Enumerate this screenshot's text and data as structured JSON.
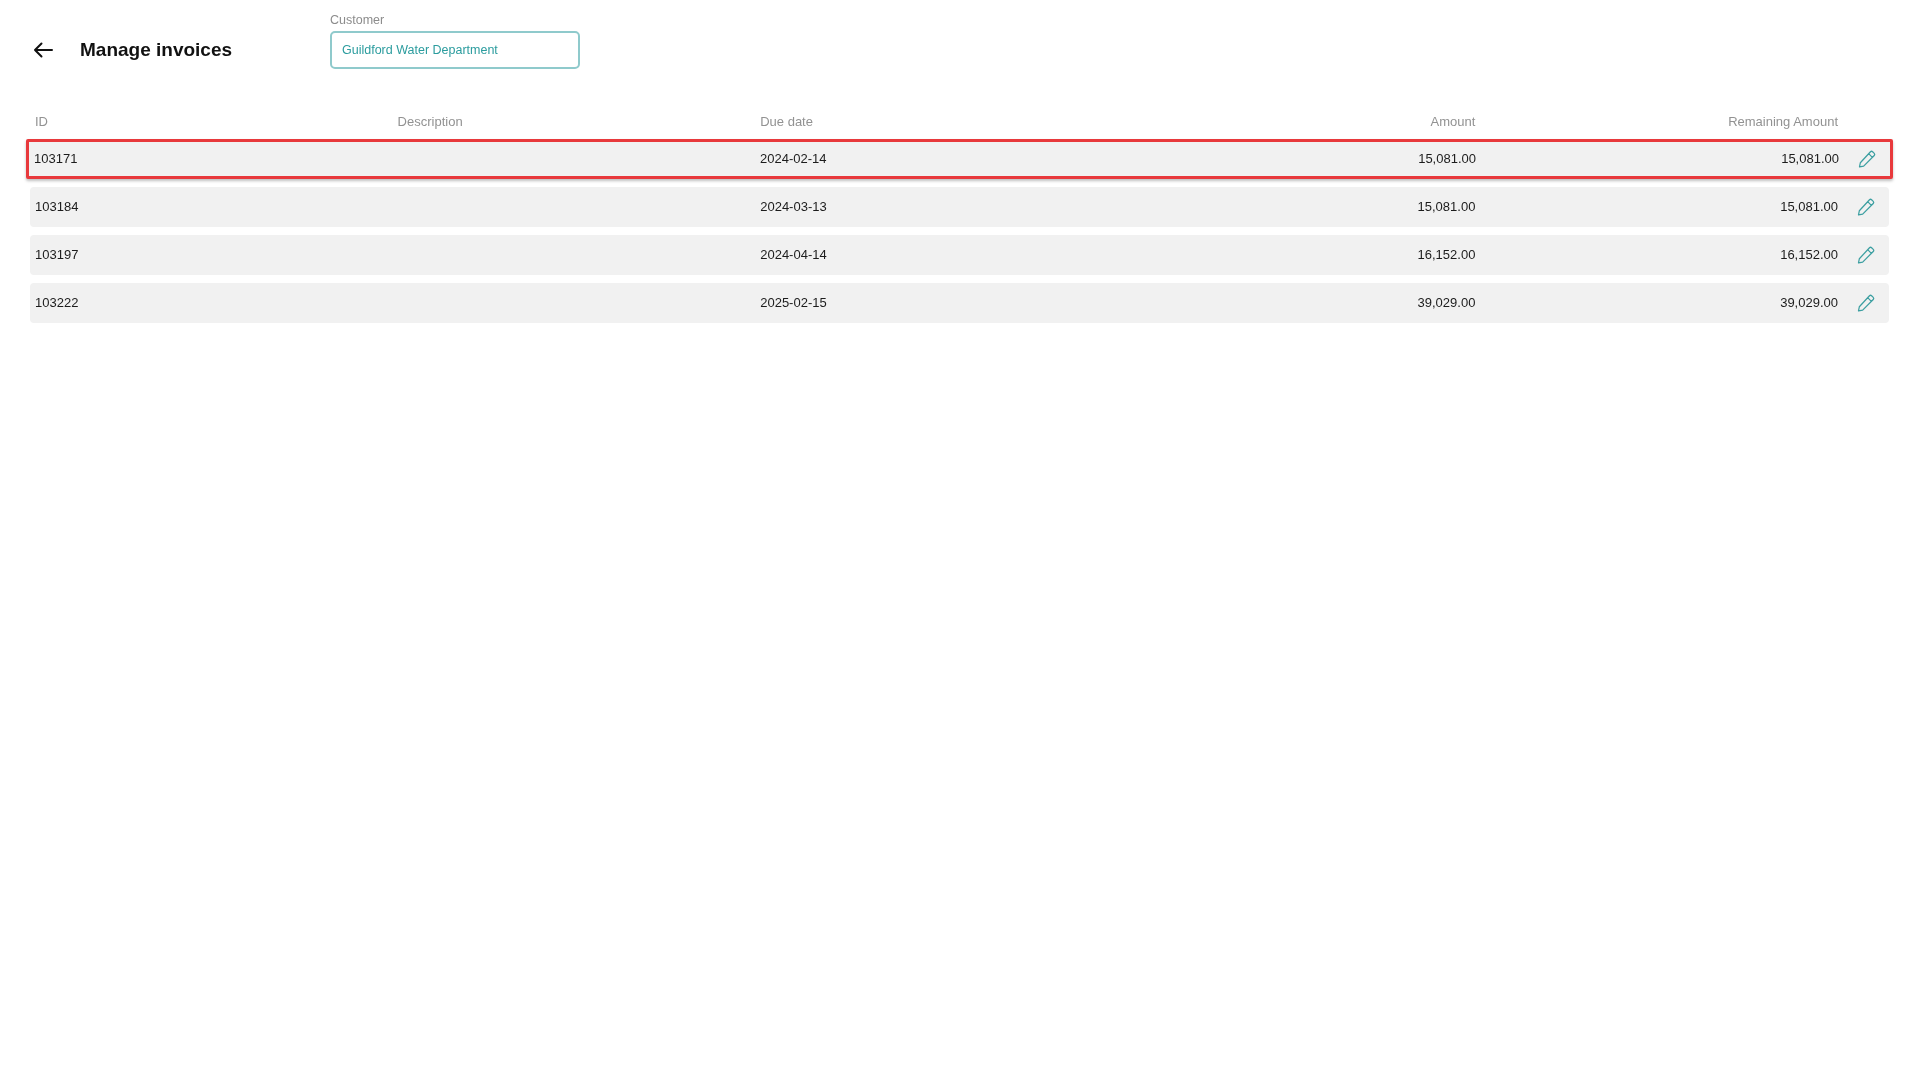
{
  "header": {
    "title": "Manage invoices"
  },
  "customer_field": {
    "label": "Customer",
    "value": "Guildford Water Department"
  },
  "table": {
    "columns": [
      "ID",
      "Description",
      "Due date",
      "Amount",
      "Remaining Amount"
    ],
    "rows": [
      {
        "id": "103171",
        "due_date": "2024-02-14",
        "amount": "15,081.00",
        "remaining_amount": "15,081.00",
        "selected": true
      },
      {
        "id": "103184",
        "due_date": "2024-03-13",
        "amount": "15,081.00",
        "remaining_amount": "15,081.00",
        "selected": false
      },
      {
        "id": "103197",
        "due_date": "2024-04-14",
        "amount": "16,152.00",
        "remaining_amount": "16,152.00",
        "selected": false
      },
      {
        "id": "103222",
        "due_date": "2025-02-15",
        "amount": "39,029.00",
        "remaining_amount": "39,029.00",
        "selected": false
      }
    ]
  }
}
